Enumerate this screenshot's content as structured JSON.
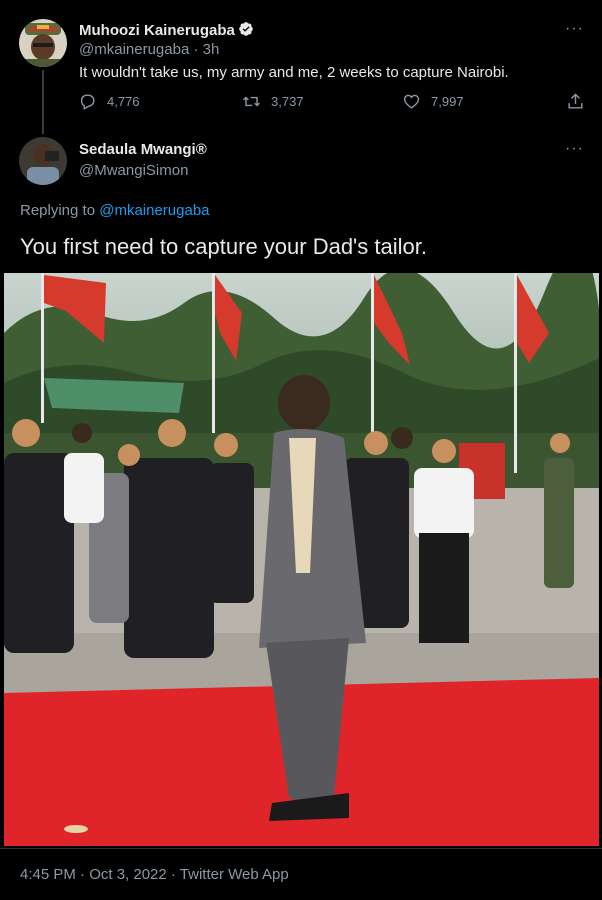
{
  "tweet1": {
    "name": "Muhoozi Kainerugaba",
    "handle": "@mkainerugaba",
    "time": "3h",
    "text": "It wouldn't take us, my army and me, 2 weeks to capture Nairobi.",
    "replies": "4,776",
    "retweets": "3,737",
    "likes": "7,997",
    "verified": true
  },
  "tweet2": {
    "name": "Sedaula Mwangi®",
    "handle": "@MwangiSimon",
    "replying_prefix": "Replying to",
    "replying_to": "@mkainerugaba",
    "text": "You first need to capture your Dad's tailor."
  },
  "footer": {
    "text": "4:45 PM · Oct 3, 2022 · Twitter Web App"
  },
  "colors": {
    "background": "#000000",
    "link": "#1d9bf0",
    "muted": "#8b98a5",
    "text": "#e7e9ea",
    "carpet": "#e0252a"
  },
  "icons": [
    "more-icon",
    "verified-icon",
    "reply-icon",
    "retweet-icon",
    "like-icon",
    "share-icon"
  ]
}
